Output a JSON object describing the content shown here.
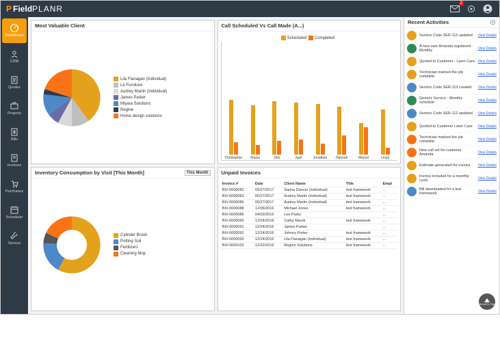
{
  "brand": {
    "prefix": "P",
    "field": "Field",
    "planr": "PLANR"
  },
  "topbar": {
    "notification_badge": "2"
  },
  "sidebar": {
    "items": [
      {
        "label": "Dashboard"
      },
      {
        "label": "CRM"
      },
      {
        "label": "Quotes"
      },
      {
        "label": "Projects"
      },
      {
        "label": "Bills"
      },
      {
        "label": "Invoices"
      },
      {
        "label": "Purchases"
      },
      {
        "label": "Scheduler"
      },
      {
        "label": "Service"
      }
    ]
  },
  "panels": {
    "client": {
      "title": "Most Valuable Client"
    },
    "calls": {
      "title": "Call Scheduled Vs Call Made (A...)"
    },
    "inventory": {
      "title": "Inventory Consumption by Visit [This Month]",
      "filter": "This Month"
    },
    "invoices": {
      "title": "Unpaid Invoices"
    }
  },
  "rail": {
    "title": "Recent Activities",
    "link_label": "View Details",
    "scroll_label": "Scroll To Top"
  },
  "invoice_headers": {
    "invoice": "Invoice #",
    "date": "Date",
    "client": "Client Name",
    "title": "Title",
    "empl": "Empl"
  },
  "colors": {
    "amber": "#e4a11b",
    "orange": "#f97316",
    "navy": "#2b3b57",
    "blue": "#4e88c7",
    "grey": "#bfbfbf",
    "green": "#2e8b57",
    "ltgrey": "#d9d9d9",
    "purple": "#6b6ba8",
    "dkgrey": "#555"
  },
  "chart_data": [
    {
      "id": "most_valuable_client",
      "type": "pie",
      "title": "Most Valuable Client",
      "series": [
        {
          "name": "Lila Flanagan (Individual)",
          "value": 40,
          "color": "#e4a11b"
        },
        {
          "name": "Le Furniture",
          "value": 10,
          "color": "#bfbfbf"
        },
        {
          "name": "Audrey Martin (Individual)",
          "value": 8,
          "color": "#d9d9d9"
        },
        {
          "name": "James Parker",
          "value": 7,
          "color": "#6b6ba8"
        },
        {
          "name": "Miyara Solutions",
          "value": 12,
          "color": "#4e88c7"
        },
        {
          "name": "Regine",
          "value": 3,
          "color": "#2b3b57"
        },
        {
          "name": "Home design solutions",
          "value": 20,
          "color": "#f97316"
        }
      ]
    },
    {
      "id": "calls",
      "type": "bar",
      "title": "Call Scheduled Vs Call Made (All)",
      "categories": [
        "Christopher",
        "Shaun",
        "Otis",
        "Jack",
        "Jonathan",
        "Hannah",
        "Marcel",
        "Lloyd"
      ],
      "series": [
        {
          "name": "Scheduled",
          "color": "#e4a11b",
          "values": [
            80,
            72,
            78,
            76,
            74,
            70,
            46,
            66
          ]
        },
        {
          "name": "Completed",
          "color": "#f97316",
          "values": [
            18,
            14,
            20,
            22,
            16,
            28,
            40,
            10
          ]
        }
      ],
      "ylim": [
        0,
        100
      ]
    },
    {
      "id": "inventory",
      "type": "pie",
      "title": "Inventory Consumption by Visit [This Month]",
      "series": [
        {
          "name": "Cylinder Brush",
          "value": 58,
          "color": "#e4a11b"
        },
        {
          "name": "Potting Soil",
          "value": 18,
          "color": "#4e88c7"
        },
        {
          "name": "Fertilizers",
          "value": 6,
          "color": "#555"
        },
        {
          "name": "Cleaning Mop",
          "value": 18,
          "color": "#f97316"
        }
      ],
      "donut": true
    },
    {
      "id": "unpaid_invoices",
      "type": "table",
      "title": "Unpaid Invoices",
      "columns": [
        "Invoice #",
        "Date",
        "Client Name",
        "Title",
        "Empl"
      ],
      "rows": [
        [
          "INV-0000082",
          "05/27/2017",
          "Sarina Dancer (Individual)",
          "test framework",
          "..."
        ],
        [
          "INV-0000083",
          "05/27/2017",
          "Audrey Martin (Individual)",
          "test framework",
          "..."
        ],
        [
          "INV-0000086",
          "06/27/2017",
          "Audrey Martin (Individual)",
          "test framework",
          "..."
        ],
        [
          "INV-0000088",
          "12/06/2016",
          "Michael Jones",
          "test framework",
          "..."
        ],
        [
          "INV-0000089",
          "04/02/2016",
          "Lee Parks",
          "",
          "..."
        ],
        [
          "INV-0000090",
          "12/24/2016",
          "Cathy Marek",
          "test framework",
          "..."
        ],
        [
          "INV-0000091",
          "12/24/2016",
          "James Parker",
          "",
          "..."
        ],
        [
          "INV-0000092",
          "12/24/2016",
          "Johnny Porter",
          "test framework",
          "..."
        ],
        [
          "INV-0000093",
          "12/24/2016",
          "Lila Flanagan (Individual)",
          "test framework",
          "..."
        ],
        [
          "INV-0000102",
          "12/22/2016",
          "Regine Solutions",
          "test framework",
          "..."
        ]
      ]
    }
  ],
  "activities": [
    {
      "color": "#e4a11b",
      "text": "Service Code SER-112 updated"
    },
    {
      "color": "#2e8b57",
      "text": "A new user Amanda registered - Monthly"
    },
    {
      "color": "#e4a11b",
      "text": "Quoted to Customer - Lawn Care"
    },
    {
      "color": "#e4a11b",
      "text": "Technician marked the job complete"
    },
    {
      "color": "#4e88c7",
      "text": "Service Code SER-113 created"
    },
    {
      "color": "#2e8b57",
      "text": "Generic Service - Monthly schedule"
    },
    {
      "color": "#4e88c7",
      "text": "Service Code SER-112 updated"
    },
    {
      "color": "#e4a11b",
      "text": "Quoted to Customer Lawn Care"
    },
    {
      "color": "#f97316",
      "text": "Technician marked the job complete"
    },
    {
      "color": "#f97316",
      "text": "New call set for customer Amanda"
    },
    {
      "color": "#e4a11b",
      "text": "Estimate generated for Invoice"
    },
    {
      "color": "#e4a11b",
      "text": "Invoice included for a monthly cycle"
    },
    {
      "color": "#4e88c7",
      "text": "Bill downloaded for a test framework"
    }
  ]
}
